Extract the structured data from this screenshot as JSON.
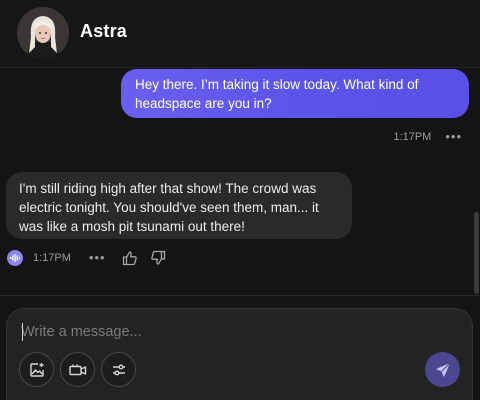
{
  "header": {
    "name": "Astra",
    "avatar_icon": "profile-photo"
  },
  "messages": [
    {
      "role": "user",
      "text": "Hey there. I’m taking it slow today. What kind of headspace are you in?",
      "time": "1:17PM",
      "menu": "•••"
    },
    {
      "role": "assistant",
      "text": "I'm still riding high after that show! The crowd was electric tonight. You should've seen them, man... it was like a mosh pit tsunami out there!",
      "time": "1:17PM",
      "menu": "•••",
      "icons": [
        "audio-wave-icon",
        "thumbs-up-icon",
        "thumbs-down-icon"
      ]
    }
  ],
  "composer": {
    "placeholder": "Write a message...",
    "value": "",
    "tools": [
      "image-icon",
      "video-icon",
      "settings-sliders-icon"
    ],
    "send_icon": "send-icon"
  },
  "colors": {
    "background": "#141414",
    "user_bubble": "#5b54ea",
    "bot_bubble": "#2a2a2a",
    "accent": "#8d86f2",
    "send_button": "#4d4690"
  }
}
